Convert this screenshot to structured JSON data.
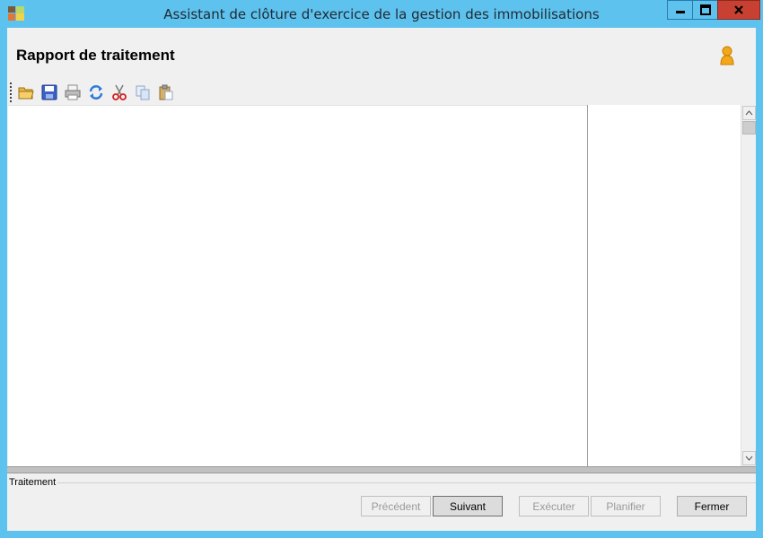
{
  "window": {
    "title": "Assistant de clôture d'exercice de la gestion des immobilisations",
    "app_icon": "app-icon",
    "controls": {
      "minimize_icon": "minimize-icon",
      "maximize_icon": "maximize-icon",
      "close_icon": "close-icon"
    },
    "frame_color": "#5ec2ee",
    "close_color": "#c84031"
  },
  "header": {
    "title": "Rapport de traitement",
    "user_icon": "user-icon"
  },
  "toolbar": {
    "items": [
      {
        "name": "open",
        "icon": "folder-open-icon"
      },
      {
        "name": "save",
        "icon": "save-icon"
      },
      {
        "name": "print",
        "icon": "print-icon"
      },
      {
        "name": "refresh",
        "icon": "refresh-icon"
      },
      {
        "name": "cut",
        "icon": "cut-icon"
      },
      {
        "name": "copy",
        "icon": "copy-icon"
      },
      {
        "name": "paste",
        "icon": "paste-icon"
      }
    ]
  },
  "status": {
    "group_label": "Traitement"
  },
  "buttons": {
    "previous": "Précédent",
    "next": "Suivant",
    "execute": "Exécuter",
    "schedule": "Planifier",
    "close": "Fermer"
  }
}
